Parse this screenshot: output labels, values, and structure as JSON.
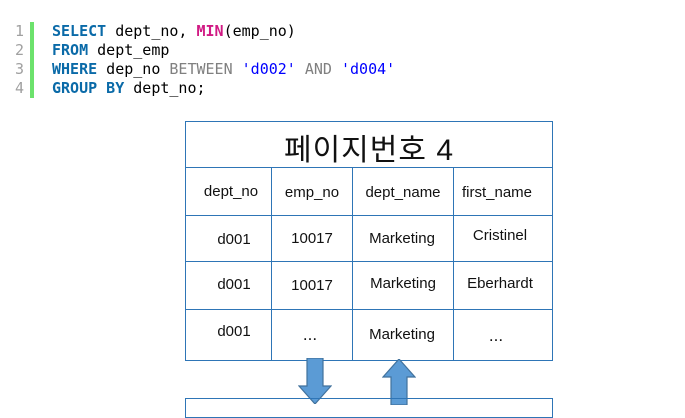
{
  "code": {
    "lines": [
      {
        "num": "1",
        "tokens": [
          {
            "text": "SELECT",
            "style": "kw"
          },
          {
            "text": " dept_no, ",
            "style": "txt"
          },
          {
            "text": "MIN",
            "style": "fn"
          },
          {
            "text": "(emp_no)",
            "style": "txt"
          }
        ]
      },
      {
        "num": "2",
        "tokens": [
          {
            "text": "FROM",
            "style": "kw"
          },
          {
            "text": " dept_emp",
            "style": "txt"
          }
        ]
      },
      {
        "num": "3",
        "tokens": [
          {
            "text": "WHERE",
            "style": "kw"
          },
          {
            "text": " dep_no ",
            "style": "txt"
          },
          {
            "text": "BETWEEN",
            "style": "op"
          },
          {
            "text": " ",
            "style": "txt"
          },
          {
            "text": "'d002'",
            "style": "str"
          },
          {
            "text": " ",
            "style": "txt"
          },
          {
            "text": "AND",
            "style": "op"
          },
          {
            "text": " ",
            "style": "txt"
          },
          {
            "text": "'d004'",
            "style": "str"
          }
        ]
      },
      {
        "num": "4",
        "tokens": [
          {
            "text": "GROUP BY",
            "style": "kw"
          },
          {
            "text": " dept_no;",
            "style": "txt"
          }
        ]
      }
    ]
  },
  "page": {
    "title": "페이지번호 4",
    "columns": [
      "dept_no",
      "emp_no",
      "dept_name",
      "first_name"
    ],
    "rows": [
      [
        "d001",
        "10017",
        "Marketing",
        "Cristinel"
      ],
      [
        "d001",
        "10017",
        "Marketing",
        "Eberhardt"
      ],
      [
        "d001",
        "...",
        "Marketing",
        "..."
      ]
    ]
  },
  "colors": {
    "border": "#2e75b6",
    "arrow_fill": "#5b9bd5",
    "arrow_stroke": "#41719c",
    "keyword": "#0a6aa8",
    "function": "#d11a84",
    "string": "#0000ff",
    "operator": "#808080",
    "gutter": "#6ce26c"
  },
  "arrows": [
    {
      "name": "down-arrow-icon",
      "direction": "down"
    },
    {
      "name": "up-arrow-icon",
      "direction": "up"
    }
  ]
}
